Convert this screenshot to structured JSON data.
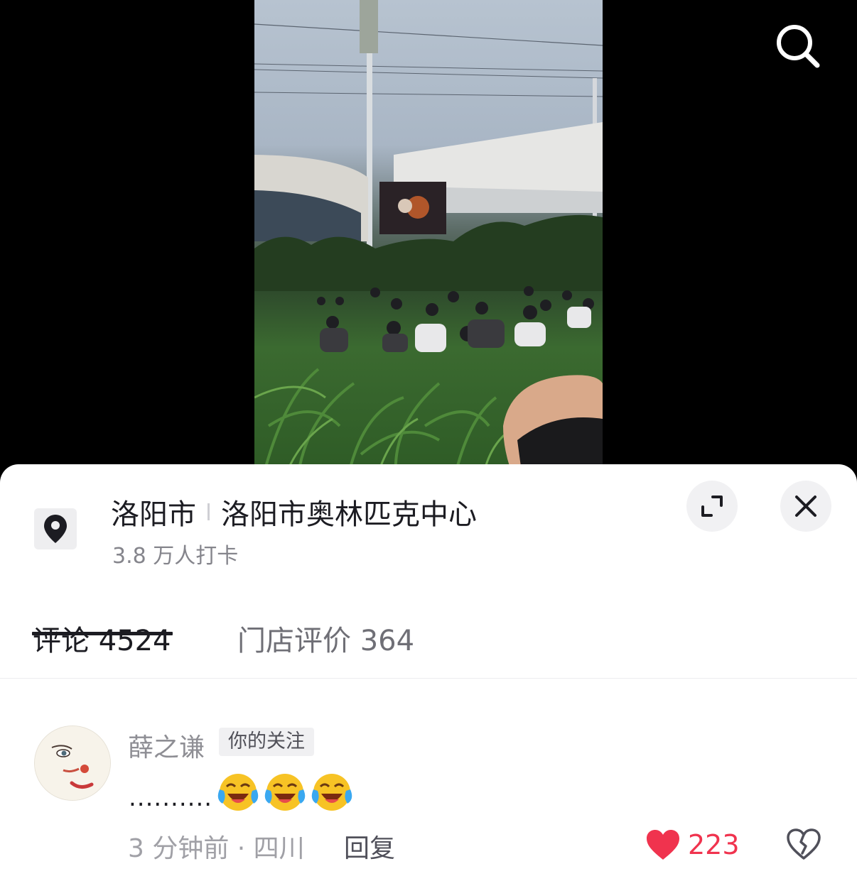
{
  "location": {
    "city": "洛阳市",
    "place": "洛阳市奥林匹克中心",
    "checkins": "3.8 万人打卡"
  },
  "tabs": [
    {
      "label": "评论 4524",
      "active": true
    },
    {
      "label": "门店评价 364",
      "active": false
    }
  ],
  "comment": {
    "username": "薛之谦",
    "badge": "你的关注",
    "text": "..........",
    "emojis": [
      "face-with-tears-of-joy-emoji",
      "face-with-tears-of-joy-emoji",
      "face-with-tears-of-joy-emoji"
    ],
    "meta": "3 分钟前 · 四川",
    "reply_label": "回复",
    "likes": "223"
  },
  "colors": {
    "like": "#f0334e",
    "text_primary": "#1c1c22",
    "text_secondary": "#85858c"
  },
  "icons": {
    "search": "search-icon",
    "location": "location-pin-icon",
    "expand": "expand-icon",
    "close": "close-icon",
    "like": "heart-icon",
    "dislike": "broken-heart-icon"
  }
}
